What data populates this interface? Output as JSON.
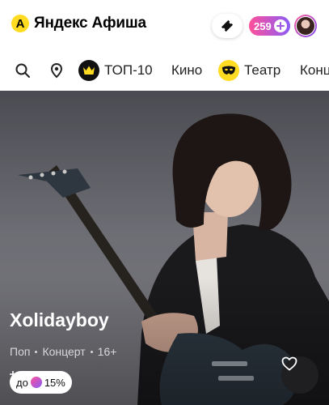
{
  "header": {
    "logo_glyph": "A",
    "logo_text": "Яндекс Афиша",
    "plus_count": "259",
    "ticket_icon": "ticket-icon",
    "avatar_icon": "user-avatar"
  },
  "nav": {
    "items": [
      {
        "label": "",
        "icon": "search-icon"
      },
      {
        "label": "",
        "icon": "location-pin-icon"
      },
      {
        "label": "ТОП-10",
        "icon": "crown-icon"
      },
      {
        "label": "Кино",
        "icon": ""
      },
      {
        "label": "Театр",
        "icon": "theatre-mask-icon"
      },
      {
        "label": "Конц",
        "icon": ""
      }
    ]
  },
  "event": {
    "title": "Xolidayboy",
    "genre": "Поп",
    "category": "Концерт",
    "age": "16+",
    "cashback_prefix": "до",
    "cashback_value": "15%",
    "favorite_icon": "heart-icon"
  },
  "colors": {
    "brand_yellow": "#ffdc22",
    "plus_gradient_start": "#ff4f9a",
    "plus_gradient_end": "#8b5cf6",
    "hero_bg": "#5d5d63"
  }
}
